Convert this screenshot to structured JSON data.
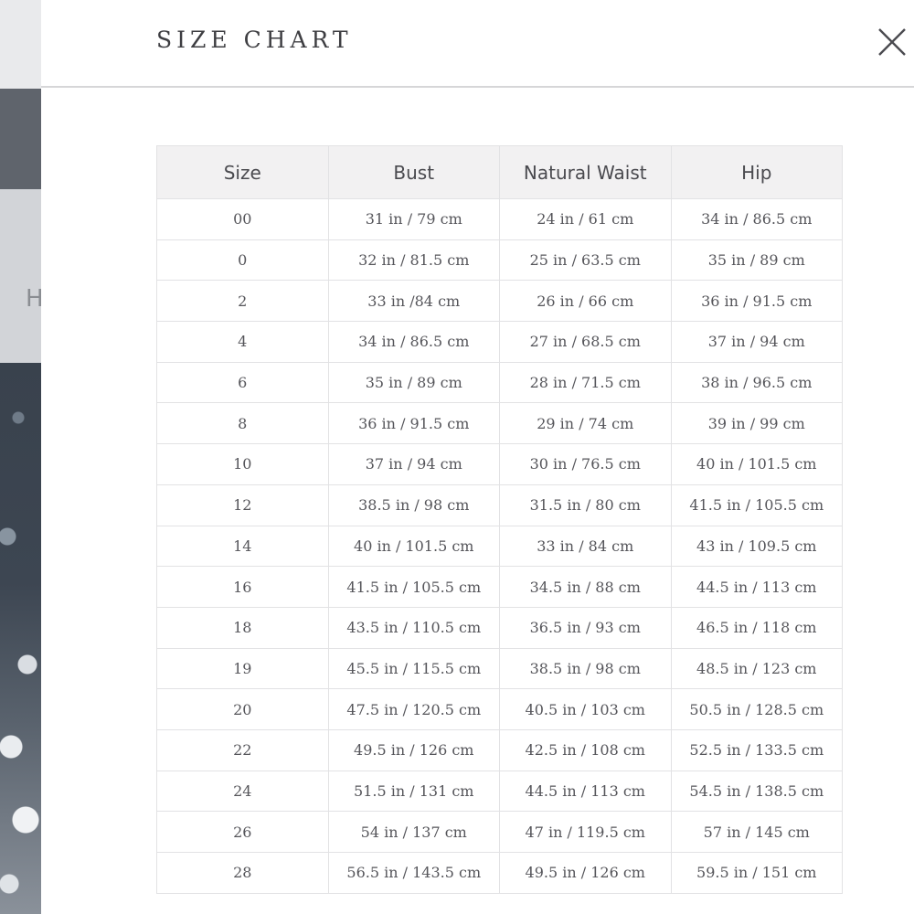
{
  "modal": {
    "title": "SIZE CHART"
  },
  "background": {
    "partial_letter": "H"
  },
  "table": {
    "headers": [
      "Size",
      "Bust",
      "Natural Waist",
      "Hip"
    ],
    "rows": [
      [
        "00",
        "31 in / 79 cm",
        "24 in / 61 cm",
        "34 in / 86.5 cm"
      ],
      [
        "0",
        "32 in / 81.5 cm",
        "25 in / 63.5 cm",
        "35 in / 89 cm"
      ],
      [
        "2",
        "33 in /84 cm",
        "26 in / 66 cm",
        "36 in / 91.5 cm"
      ],
      [
        "4",
        "34 in / 86.5 cm",
        "27 in / 68.5 cm",
        "37 in / 94 cm"
      ],
      [
        "6",
        "35 in / 89 cm",
        "28 in / 71.5 cm",
        "38 in / 96.5 cm"
      ],
      [
        "8",
        "36 in / 91.5 cm",
        "29 in / 74 cm",
        "39 in / 99 cm"
      ],
      [
        "10",
        "37 in / 94 cm",
        "30 in / 76.5 cm",
        "40 in / 101.5 cm"
      ],
      [
        "12",
        "38.5 in / 98 cm",
        "31.5 in / 80 cm",
        "41.5 in / 105.5 cm"
      ],
      [
        "14",
        "40 in / 101.5 cm",
        "33 in / 84 cm",
        "43 in / 109.5 cm"
      ],
      [
        "16",
        "41.5 in / 105.5 cm",
        "34.5 in / 88 cm",
        "44.5 in / 113 cm"
      ],
      [
        "18",
        "43.5 in / 110.5 cm",
        "36.5 in / 93 cm",
        "46.5 in / 118 cm"
      ],
      [
        "19",
        "45.5 in / 115.5 cm",
        "38.5 in / 98 cm",
        "48.5 in / 123 cm"
      ],
      [
        "20",
        "47.5 in / 120.5 cm",
        "40.5 in / 103 cm",
        "50.5 in / 128.5 cm"
      ],
      [
        "22",
        "49.5 in / 126 cm",
        "42.5 in / 108 cm",
        "52.5 in / 133.5 cm"
      ],
      [
        "24",
        "51.5 in / 131 cm",
        "44.5 in / 113 cm",
        "54.5 in / 138.5 cm"
      ],
      [
        "26",
        "54 in / 137 cm",
        "47 in / 119.5 cm",
        "57 in / 145 cm"
      ],
      [
        "28",
        "56.5 in / 143.5 cm",
        "49.5 in / 126 cm",
        "59.5 in / 151 cm"
      ]
    ]
  },
  "icons": {
    "close": "close-icon"
  },
  "colors": {
    "header_bg": "#f2f1f2",
    "text": "#55555a",
    "border": "#e2e2e4"
  }
}
